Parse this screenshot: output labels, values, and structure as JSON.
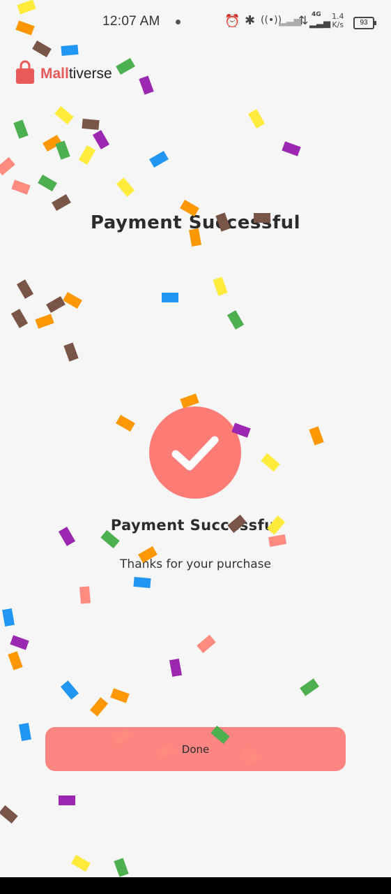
{
  "status_bar": {
    "time": "12:07 AM",
    "network_type": "4G",
    "speed_value": "1.4",
    "speed_unit": "K/s",
    "battery": "93",
    "icons": [
      "alarm-icon",
      "bluetooth-icon",
      "hotspot-icon",
      "signal-icon",
      "data-arrows-icon",
      "signal-icon",
      "battery-icon"
    ]
  },
  "app": {
    "logo_part1": "Mall",
    "logo_part2": "tiverse",
    "brand_color": "#e85a5a"
  },
  "page": {
    "title": "Payment Successful",
    "heading": "Payment Successful",
    "subtitle": "Thanks for your purchase",
    "done_label": "Done",
    "accent_color": "#ff7b76"
  }
}
